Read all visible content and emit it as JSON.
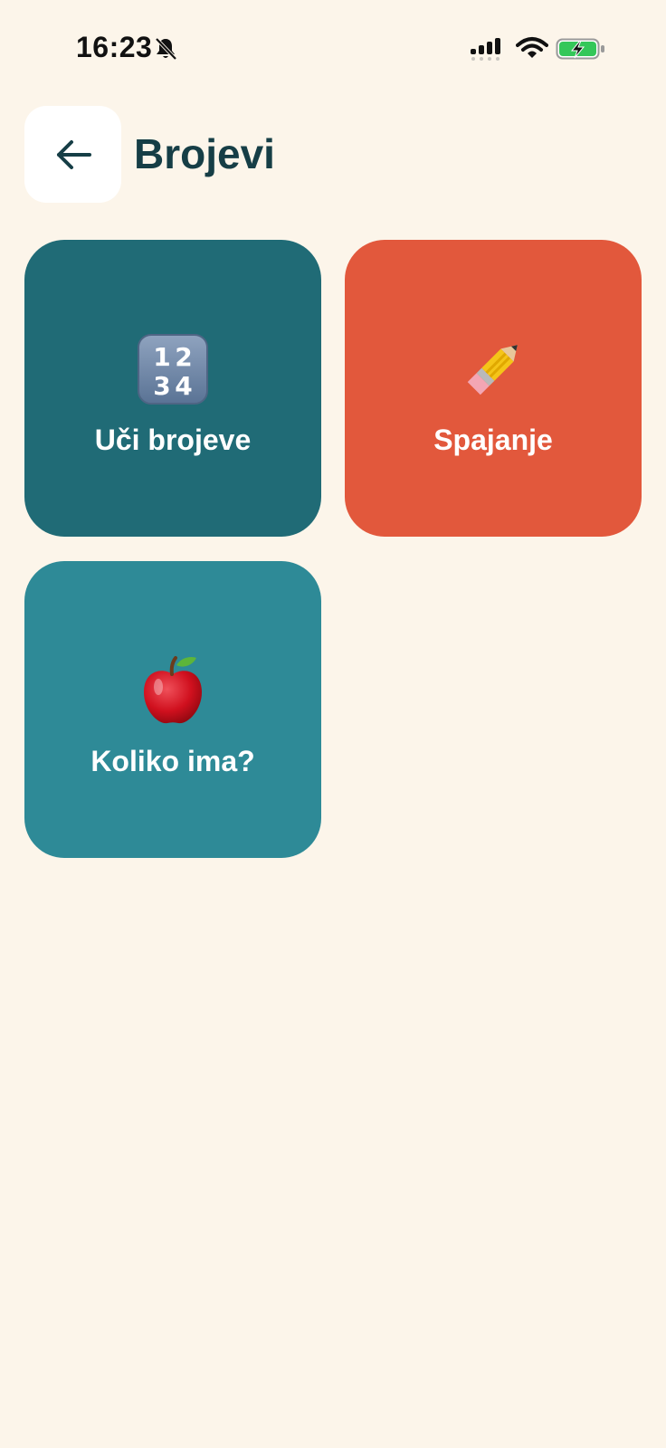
{
  "status_bar": {
    "time": "16:23",
    "icons": [
      "bell-slash-icon",
      "cellular-signal-icon",
      "wifi-icon",
      "battery-charging-icon"
    ],
    "battery_color": "#34C759"
  },
  "header": {
    "back_icon": "arrow-left-icon",
    "title": "Brojevi"
  },
  "tiles": [
    {
      "label": "Uči brojeve",
      "icon": "numbers-1234-icon",
      "color": "#206B76"
    },
    {
      "label": "Spajanje",
      "icon": "pencil-icon",
      "color": "#E2583C"
    },
    {
      "label": "Koliko ima?",
      "icon": "red-apple-icon",
      "color": "#2E8A97"
    }
  ],
  "colors": {
    "background": "#FCF5EA",
    "title": "#163E46"
  }
}
